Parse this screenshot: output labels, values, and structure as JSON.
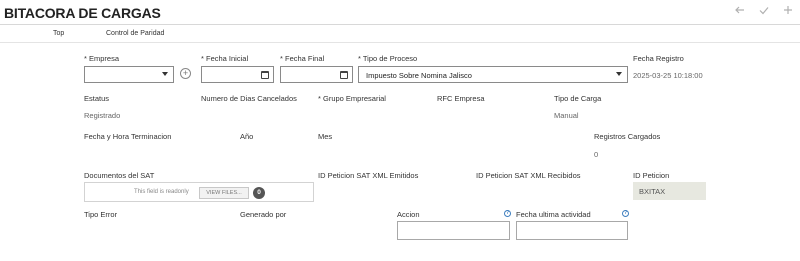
{
  "header": {
    "title": "BITACORA DE CARGAS",
    "icons": [
      "back-arrow-icon",
      "checkmark-icon",
      "plus-icon"
    ]
  },
  "tabs": [
    {
      "label": "Top"
    },
    {
      "label": "Control de Paridad"
    }
  ],
  "row1": {
    "empresa_label": "* Empresa",
    "empresa_value": "",
    "fecha_inicial_label": "* Fecha Inicial",
    "fecha_inicial_value": "",
    "fecha_final_label": "* Fecha Final",
    "fecha_final_value": "",
    "tipo_proceso_label": "* Tipo de Proceso",
    "tipo_proceso_value": "Impuesto Sobre Nomina Jalisco",
    "fecha_registro_label": "Fecha Registro",
    "fecha_registro_value": "2025-03-25 10:18:00"
  },
  "row2": {
    "estatus_label": "Estatus",
    "estatus_value": "Registrado",
    "dias_cancelados_label": "Numero de Dias Cancelados",
    "grupo_label": "* Grupo Empresarial",
    "rfc_label": "RFC Empresa",
    "tipo_carga_label": "Tipo de Carga",
    "tipo_carga_value": "Manual"
  },
  "row3": {
    "fecha_hora_label": "Fecha y Hora Terminacion",
    "anio_label": "Año",
    "mes_label": "Mes",
    "registros_label": "Registros Cargados",
    "registros_value": "0"
  },
  "row4": {
    "documentos_label": "Documentos del SAT",
    "readonly_text": "This field is readonly",
    "view_files_label": "VIEW FILES...",
    "files_count": "0",
    "emitidos_label": "ID Peticion SAT XML Emitidos",
    "recibidos_label": "ID Peticion SAT XML Recibidos",
    "id_peticion_label": "ID Peticion",
    "id_peticion_value": "BXITAX"
  },
  "row5": {
    "tipo_error_label": "Tipo Error",
    "generado_label": "Generado por",
    "accion_label": "Accion",
    "accion_value": "",
    "fecha_actividad_label": "Fecha ultima actividad",
    "fecha_actividad_value": ""
  },
  "colors": {
    "readonly_bg": "#e7e8e0",
    "help_blue": "#3f7fbf"
  }
}
